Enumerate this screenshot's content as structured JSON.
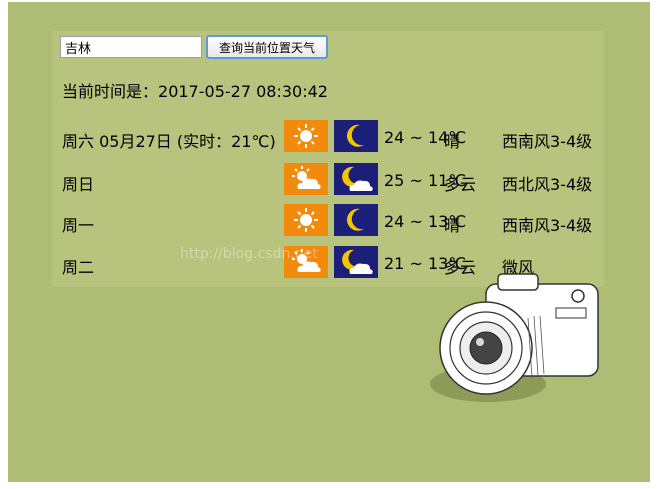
{
  "search": {
    "value": "吉林",
    "button_label": "查询当前位置天气"
  },
  "current_time": {
    "label": "当前时间是：",
    "value": "2017-05-27 08:30:42"
  },
  "forecast": [
    {
      "day": "周六 05月27日 (实时：21℃)",
      "day_icon": "sun-icon",
      "night_icon": "moon-icon",
      "temps": "24 ~ 14℃",
      "condition": "晴",
      "wind": "西南风3-4级"
    },
    {
      "day": "周日",
      "day_icon": "partly-cloudy-icon",
      "night_icon": "cloudy-moon-icon",
      "temps": "25 ~ 11℃",
      "condition": "多云",
      "wind": "西北风3-4级"
    },
    {
      "day": "周一",
      "day_icon": "sun-icon",
      "night_icon": "moon-icon",
      "temps": "24 ~ 13℃",
      "condition": "晴",
      "wind": "西南风3-4级"
    },
    {
      "day": "周二",
      "day_icon": "partly-cloudy-icon",
      "night_icon": "cloudy-moon-icon",
      "temps": "21 ~ 13℃",
      "condition": "多云",
      "wind": "微风"
    }
  ],
  "watermark": "http://blog.csdn.net",
  "colors": {
    "background": "#adbe74",
    "panel": "#b8c47e",
    "day_icon_bg": "#f28a0c",
    "night_icon_bg": "#1b1f78"
  }
}
